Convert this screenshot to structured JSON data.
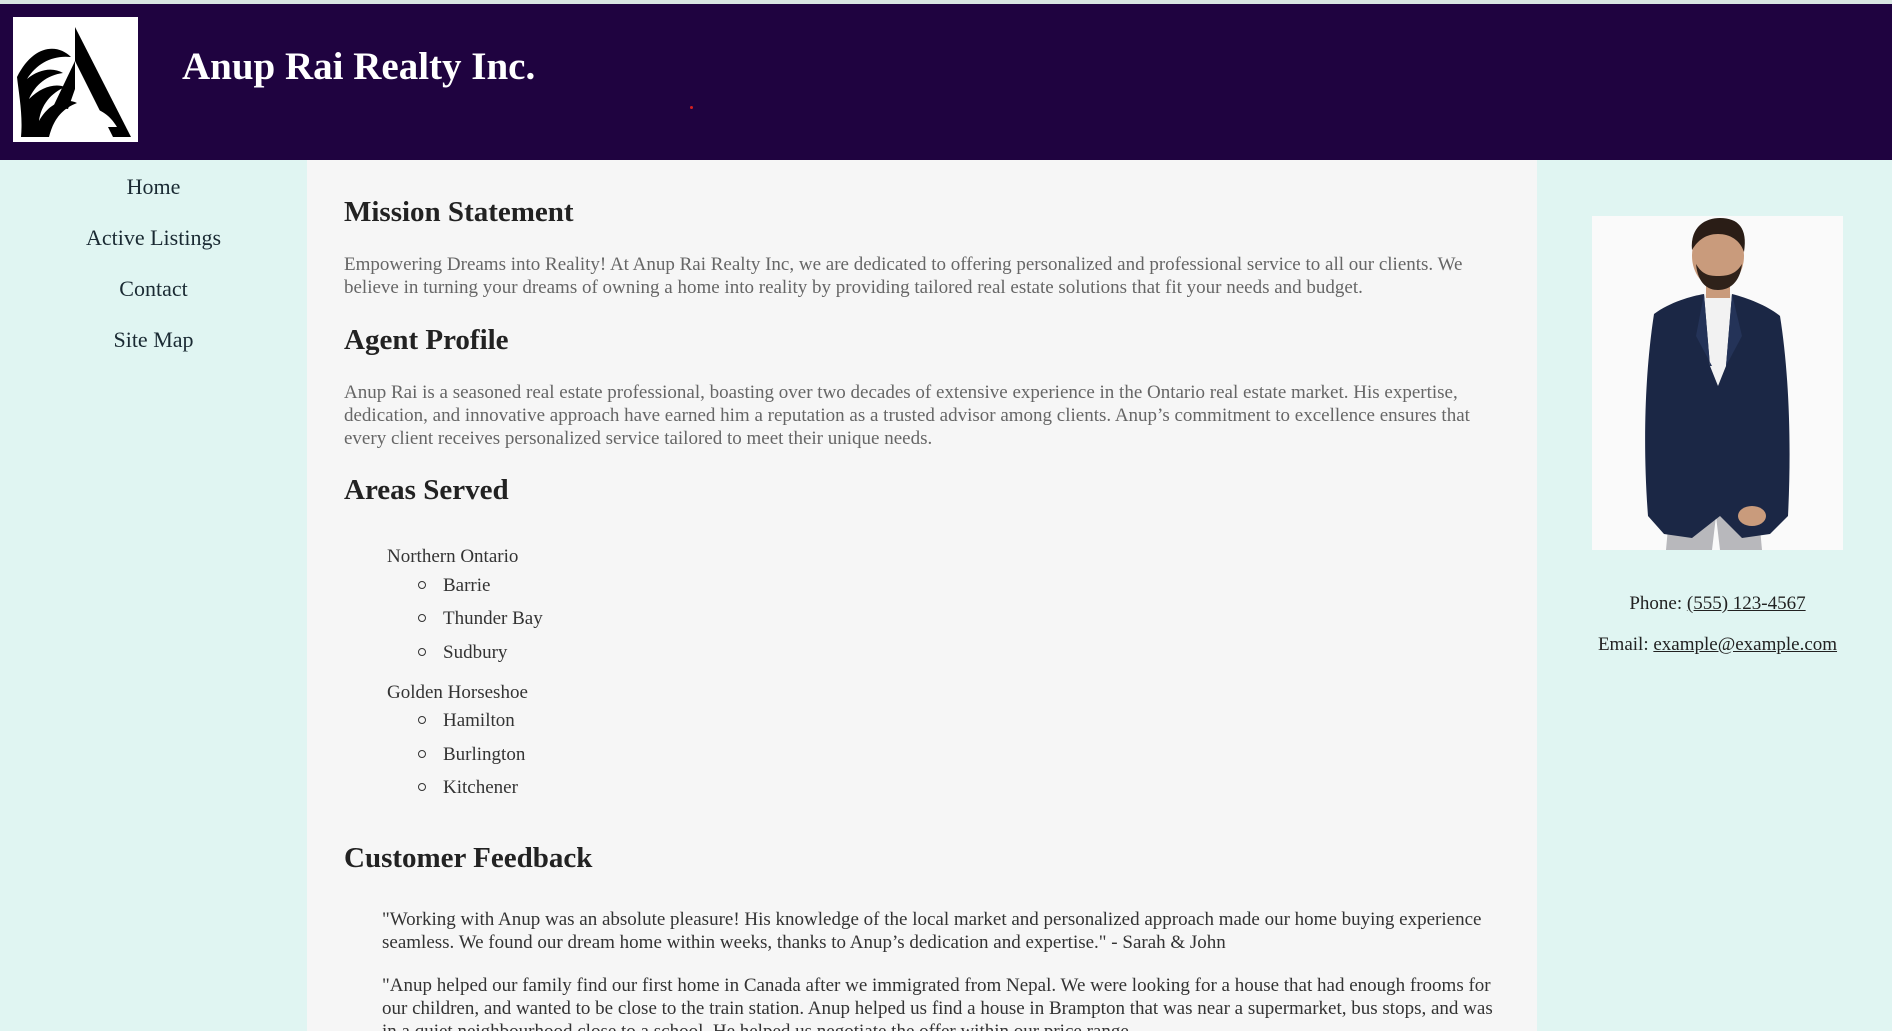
{
  "header": {
    "title": "Anup Rai Realty Inc.",
    "logo_icon": "eagle-a-logo",
    "background": "#1f0340"
  },
  "nav": {
    "items": [
      {
        "label": "Home"
      },
      {
        "label": "Active Listings"
      },
      {
        "label": "Contact"
      },
      {
        "label": "Site Map"
      }
    ]
  },
  "main": {
    "mission": {
      "heading": "Mission Statement",
      "text": "Empowering Dreams into Reality! At Anup Rai Realty Inc, we are dedicated to offering personalized and professional service to all our clients. We believe in turning your dreams of owning a home into reality by providing tailored real estate solutions that fit your needs and budget."
    },
    "profile": {
      "heading": "Agent Profile",
      "text": "Anup Rai is a seasoned real estate professional, boasting over two decades of extensive experience in the Ontario real estate market. His expertise, dedication, and innovative approach have earned him a reputation as a trusted advisor among clients. Anup’s commitment to excellence ensures that every client receives personalized service tailored to meet their unique needs."
    },
    "areas": {
      "heading": "Areas Served",
      "regions": [
        {
          "name": "Northern Ontario",
          "cities": [
            "Barrie",
            "Thunder Bay",
            "Sudbury"
          ]
        },
        {
          "name": "Golden Horseshoe",
          "cities": [
            "Hamilton",
            "Burlington",
            "Kitchener"
          ]
        }
      ]
    },
    "feedback": {
      "heading": "Customer Feedback",
      "quotes": [
        "\"Working with Anup was an absolute pleasure! His knowledge of the local market and personalized approach made our home buying experience seamless. We found our dream home within weeks, thanks to Anup’s dedication and expertise.\" - Sarah & John",
        "\"Anup helped our family find our first home in Canada after we immigrated from Nepal. We were looking for a house that had enough frooms for our children, and wanted to be close to the train station. Anup helped us find a house in Brampton that was near a supermarket, bus stops, and was in a quiet neighbourhood close to a school. He helped us negotiate the offer within our price range"
      ]
    }
  },
  "aside": {
    "photo_icon": "agent-photo",
    "phone_label": "Phone: ",
    "phone": "(555) 123-4567",
    "email_label": "Email: ",
    "email": "example@example.com"
  }
}
